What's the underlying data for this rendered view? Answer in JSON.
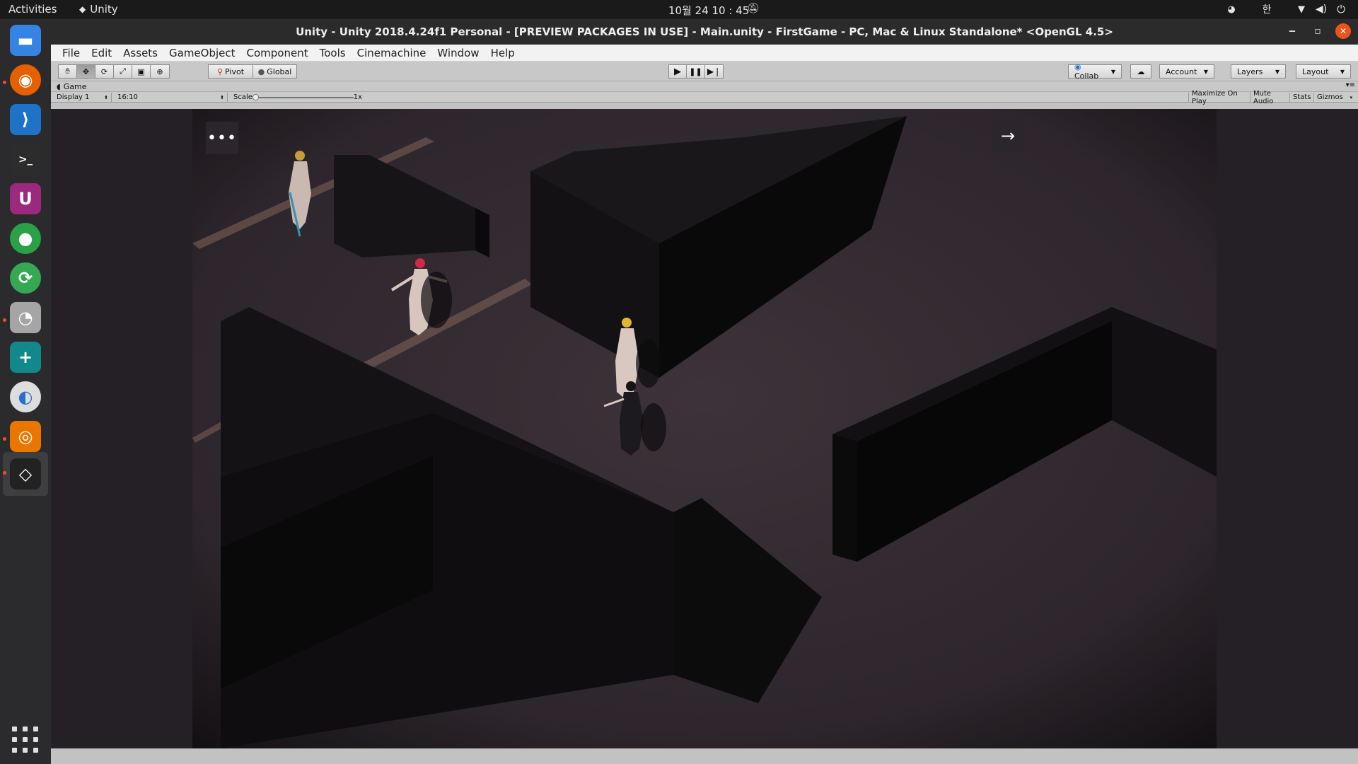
{
  "topbar": {
    "activities": "Activities",
    "app_name": "Unity",
    "clock": "10월 24  10 : 45",
    "ime": "한"
  },
  "dock": {
    "items": [
      {
        "name": "files",
        "glyph": "▬",
        "color": "#3584e4"
      },
      {
        "name": "firefox",
        "glyph": "◉",
        "color": "#e66000"
      },
      {
        "name": "vscode",
        "glyph": "⟩",
        "color": "#1e73c8"
      },
      {
        "name": "terminal",
        "glyph": ">_",
        "color": "#2c2c2c"
      },
      {
        "name": "unity-hub",
        "glyph": "U",
        "color": "#9b2a7f"
      },
      {
        "name": "chrome",
        "glyph": "●",
        "color": "#2aa147"
      },
      {
        "name": "sync",
        "glyph": "⟳",
        "color": "#35a853"
      },
      {
        "name": "screenshot",
        "glyph": "◔",
        "color": "#a5a5a5"
      },
      {
        "name": "usb-creator",
        "glyph": "+",
        "color": "#12888b"
      },
      {
        "name": "kde-connect",
        "glyph": "◐",
        "color": "#dddddd"
      },
      {
        "name": "blender",
        "glyph": "◎",
        "color": "#ea7600"
      },
      {
        "name": "unity",
        "glyph": "◇",
        "color": "#222222"
      }
    ]
  },
  "window": {
    "title": "Unity - Unity 2018.4.24f1 Personal - [PREVIEW PACKAGES IN USE] - Main.unity - FirstGame - PC, Mac & Linux Standalone* <OpenGL 4.5>"
  },
  "menu": [
    "File",
    "Edit",
    "Assets",
    "GameObject",
    "Component",
    "Tools",
    "Cinemachine",
    "Window",
    "Help"
  ],
  "toolbar": {
    "pivot": "Pivot",
    "global": "Global",
    "collab": "Collab",
    "account": "Account",
    "layers": "Layers",
    "layout": "Layout"
  },
  "game": {
    "tab_label": "Game",
    "display": "Display 1",
    "aspect": "16:10",
    "scale_label": "Scale",
    "scale_value": "1x",
    "scale_fraction": 0.0,
    "maximize_on_play": "Maximize On Play",
    "mute_audio": "Mute Audio",
    "stats": "Stats",
    "gizmos": "Gizmos"
  },
  "colors": {
    "floor": "#3a3139",
    "wall_top": "#121012",
    "wall_side": "#0a090a",
    "walkway": "#6a5450",
    "accent": "#e95420"
  }
}
